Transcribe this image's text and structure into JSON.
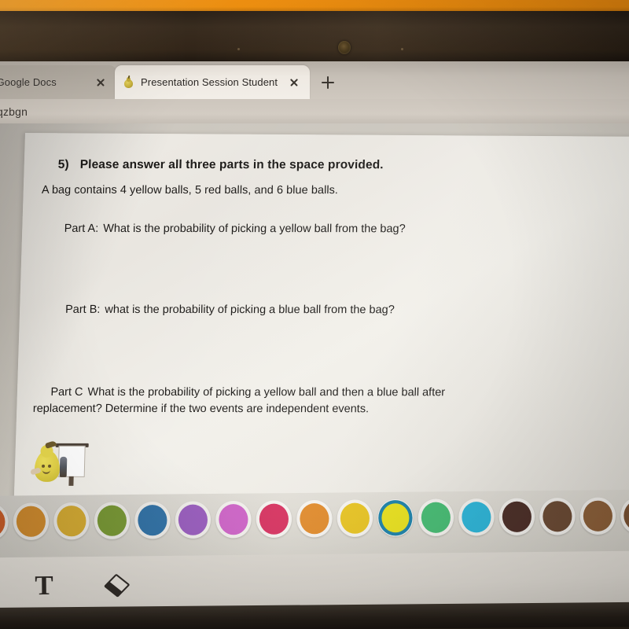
{
  "browser": {
    "tabs": [
      {
        "title": "eview - Google Docs",
        "active": false,
        "favicon": "none",
        "close_icon": "close-icon"
      },
      {
        "title": "Presentation Session Student",
        "active": true,
        "favicon": "pear-icon",
        "close_icon": "close-icon"
      }
    ],
    "new_tab_label": "+",
    "url_fragment": "qzbgn"
  },
  "document": {
    "question_number": "5)",
    "question_title": "Please answer all three parts in the space provided.",
    "intro": "A bag contains 4 yellow balls, 5 red balls, and 6 blue balls.",
    "part_a_label": "Part A:",
    "part_a_text": "What is the probability of picking a yellow ball from the bag?",
    "part_b_label": "Part B:",
    "part_b_text": "what is the probability of picking a blue ball from the bag?",
    "part_c_label": "Part C",
    "part_c_line1": "What is the probability of picking a yellow ball and then a blue ball after",
    "part_c_line2": "replacement?  Determine if the two events are independent events.",
    "sticker_name": "pear-teacher-sticker"
  },
  "palette": {
    "selected_index": 10,
    "selection_ring_color": "#1b80a8",
    "swatches": [
      {
        "name": "red-orange",
        "color": "#d4622a"
      },
      {
        "name": "orange",
        "color": "#d9912f"
      },
      {
        "name": "gold",
        "color": "#ddb133"
      },
      {
        "name": "olive-green",
        "color": "#7a9b33"
      },
      {
        "name": "blue",
        "color": "#2f72a8"
      },
      {
        "name": "purple",
        "color": "#9a5cc0"
      },
      {
        "name": "magenta",
        "color": "#cf63c8"
      },
      {
        "name": "crimson",
        "color": "#d6305e"
      },
      {
        "name": "amber",
        "color": "#e08a2a"
      },
      {
        "name": "yellow",
        "color": "#e7c321"
      },
      {
        "name": "bright-yellow",
        "color": "#e8e01c"
      },
      {
        "name": "green",
        "color": "#45bb72"
      },
      {
        "name": "cyan",
        "color": "#2cb5d8"
      },
      {
        "name": "dark-brown",
        "color": "#4b2d26"
      },
      {
        "name": "brown",
        "color": "#6b4a33"
      },
      {
        "name": "light-brown",
        "color": "#8d6039"
      },
      {
        "name": "tan-brown",
        "color": "#7c5233"
      }
    ]
  },
  "toolbar": {
    "tools": [
      {
        "name": "text-tool",
        "glyph": "T",
        "label": "Text"
      },
      {
        "name": "eraser-tool",
        "glyph": "diamond",
        "label": "Eraser"
      }
    ]
  },
  "device": {
    "webcam": "webcam-icon",
    "wall_color": "#f3920f",
    "bezel_color": "#332619"
  }
}
